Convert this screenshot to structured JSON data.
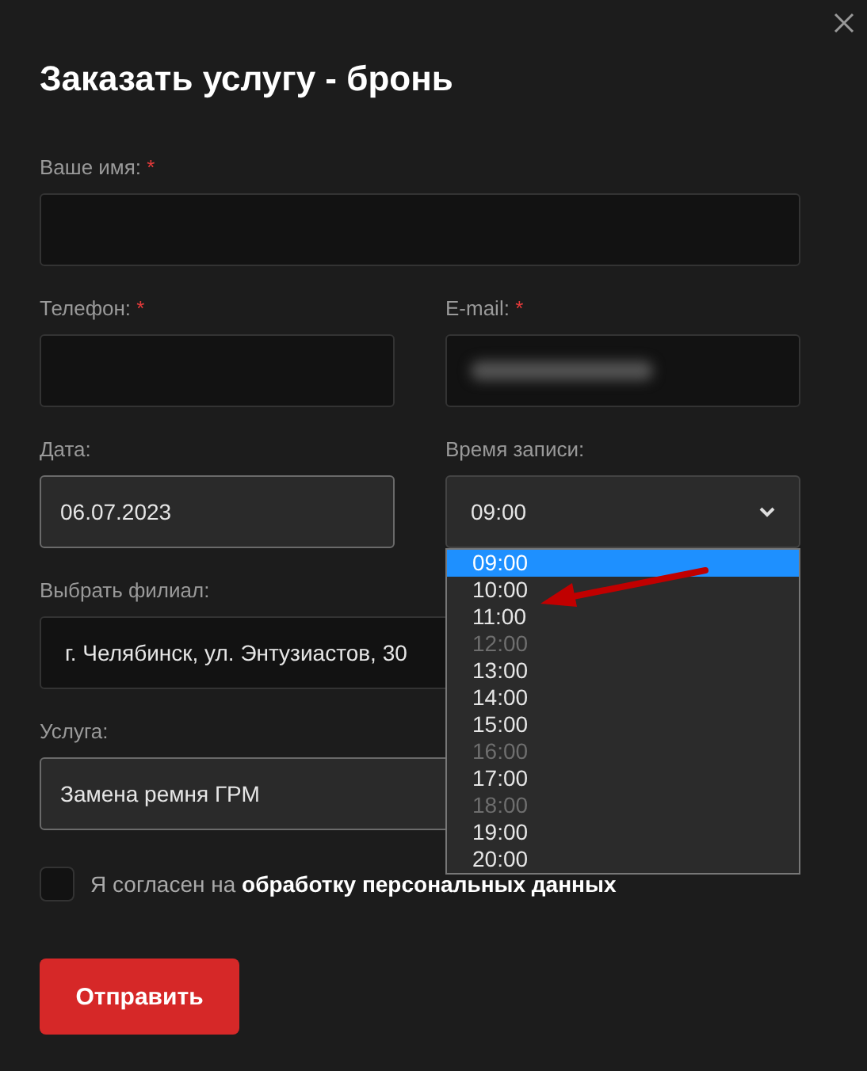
{
  "dialog": {
    "title": "Заказать услугу - бронь",
    "rows": [
      [
        {
          "label": "Ваше имя:",
          "kind": "text",
          "required_mark": "*"
        }
      ],
      [
        {
          "label": "Телефон:",
          "kind": "text",
          "required_mark": "*"
        },
        {
          "label": "E-mail:",
          "kind": "blurred",
          "required_mark": "*"
        }
      ],
      [
        {
          "label": "Дата:",
          "kind": "date",
          "value": "06.07.2023"
        },
        {
          "label": "Время записи:",
          "kind": "select",
          "value": "09:00",
          "open": true
        }
      ],
      [
        {
          "label": "Выбрать филиал:",
          "kind": "text",
          "value": "г. Челябинск, ул. Энтузиастов, 30"
        }
      ],
      [
        {
          "label": "Услуга:",
          "kind": "date",
          "value": "Замена ремня ГРМ"
        }
      ]
    ],
    "time_options": [
      {
        "label": "09:00",
        "selected": true,
        "disabled": false
      },
      {
        "label": "10:00",
        "selected": false,
        "disabled": false
      },
      {
        "label": "11:00",
        "selected": false,
        "disabled": false
      },
      {
        "label": "12:00",
        "selected": false,
        "disabled": true
      },
      {
        "label": "13:00",
        "selected": false,
        "disabled": false
      },
      {
        "label": "14:00",
        "selected": false,
        "disabled": false
      },
      {
        "label": "15:00",
        "selected": false,
        "disabled": false
      },
      {
        "label": "16:00",
        "selected": false,
        "disabled": true
      },
      {
        "label": "17:00",
        "selected": false,
        "disabled": false
      },
      {
        "label": "18:00",
        "selected": false,
        "disabled": true
      },
      {
        "label": "19:00",
        "selected": false,
        "disabled": false
      },
      {
        "label": "20:00",
        "selected": false,
        "disabled": false
      }
    ],
    "consent": {
      "text": "Я согласен на **обработку персональных данных**",
      "checked": false
    },
    "submit": "Отправить"
  }
}
